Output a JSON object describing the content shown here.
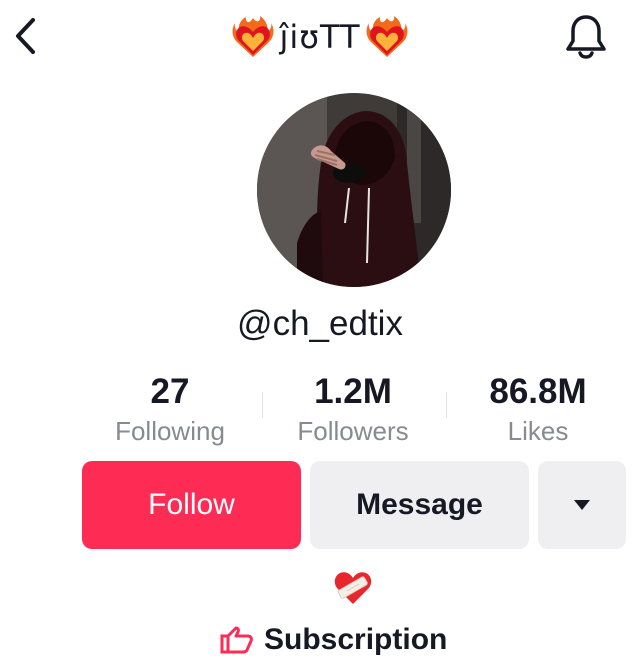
{
  "header": {
    "title": "ĵiʊTT",
    "icons": {
      "back": "chevron-left-icon",
      "bell": "bell-icon",
      "title_decoration": "heart-on-fire-emoji"
    }
  },
  "profile": {
    "username": "@ch_edtix",
    "avatar": "hooded-figure-photo"
  },
  "stats": {
    "following": {
      "value": "27",
      "label": "Following"
    },
    "followers": {
      "value": "1.2M",
      "label": "Followers"
    },
    "likes": {
      "value": "86.8M",
      "label": "Likes"
    }
  },
  "actions": {
    "follow_label": "Follow",
    "message_label": "Message",
    "more_icon": "caret-down-icon"
  },
  "bio": {
    "emoji": "mending-heart-emoji"
  },
  "subscription": {
    "label": "Subscription",
    "icon": "subscription-icon"
  },
  "colors": {
    "accent": "#fe2c55",
    "secondary_button": "#efeff1",
    "muted_text": "#888a92",
    "text": "#161823"
  }
}
